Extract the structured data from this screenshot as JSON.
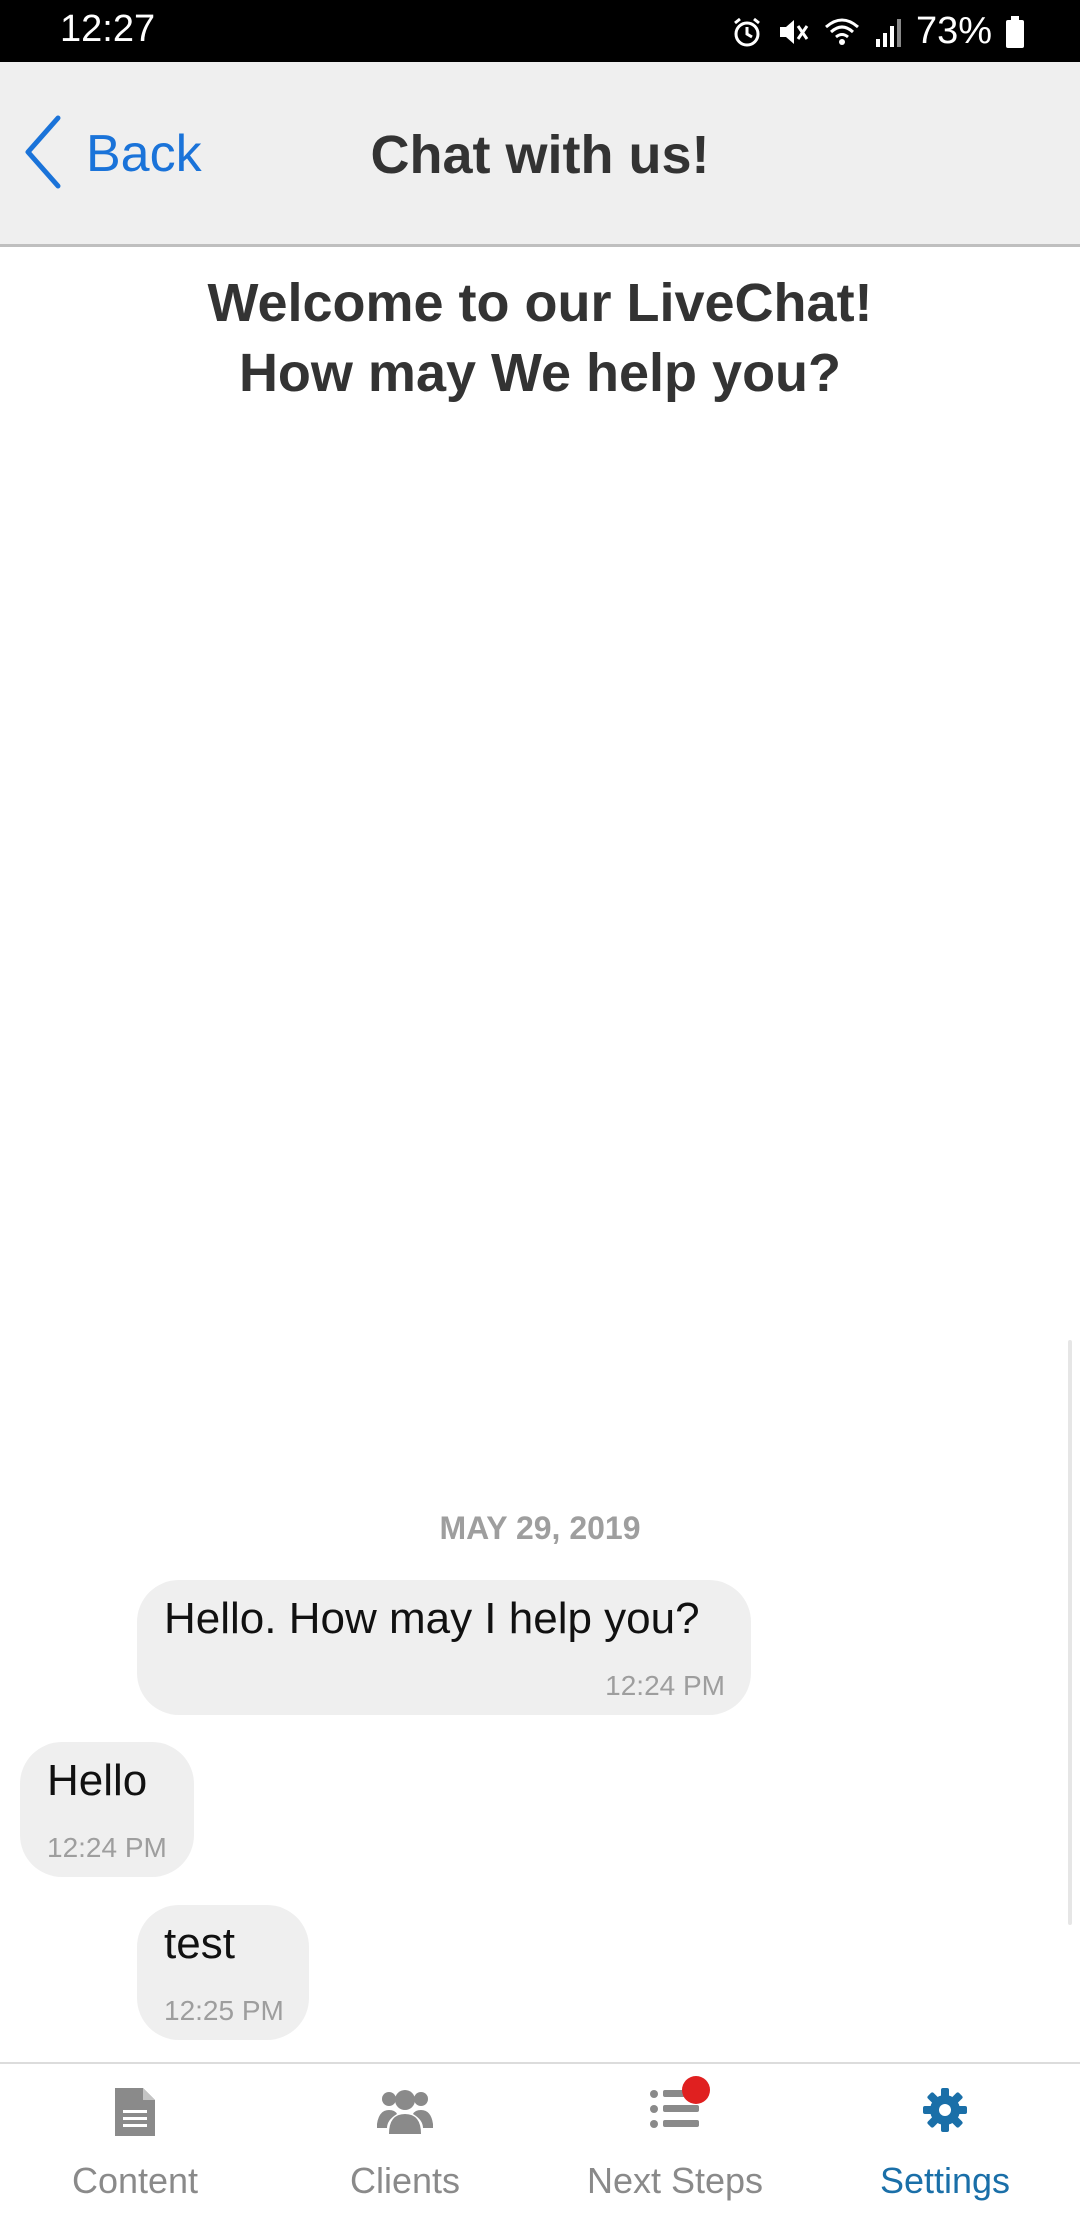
{
  "status_bar": {
    "time": "12:27",
    "battery": "73%",
    "icons": [
      "alarm-icon",
      "mute-icon",
      "wifi-icon",
      "signal-icon",
      "battery-icon"
    ]
  },
  "header": {
    "back_label": "Back",
    "title": "Chat with us!"
  },
  "welcome": {
    "line1": "Welcome to our LiveChat!",
    "line2": "How may We help you?"
  },
  "chat": {
    "date": "MAY 29, 2019",
    "messages": [
      {
        "text": "Hello. How may I help you?",
        "time": "12:24 PM"
      },
      {
        "text": "Hello",
        "time": "12:24 PM"
      },
      {
        "text": "test",
        "time": "12:25 PM"
      }
    ]
  },
  "tabs": [
    {
      "label": "Content",
      "icon": "document-icon"
    },
    {
      "label": "Clients",
      "icon": "users-icon"
    },
    {
      "label": "Next Steps",
      "icon": "list-icon",
      "badge": true
    },
    {
      "label": "Settings",
      "icon": "gear-icon",
      "active": true
    }
  ],
  "colors": {
    "accent": "#1a73d9",
    "active_tab": "#1a6fa8",
    "inactive_tab": "#8a8a8a",
    "badge": "#e02020",
    "bubble": "#efefef",
    "header_bg": "#efefef"
  }
}
